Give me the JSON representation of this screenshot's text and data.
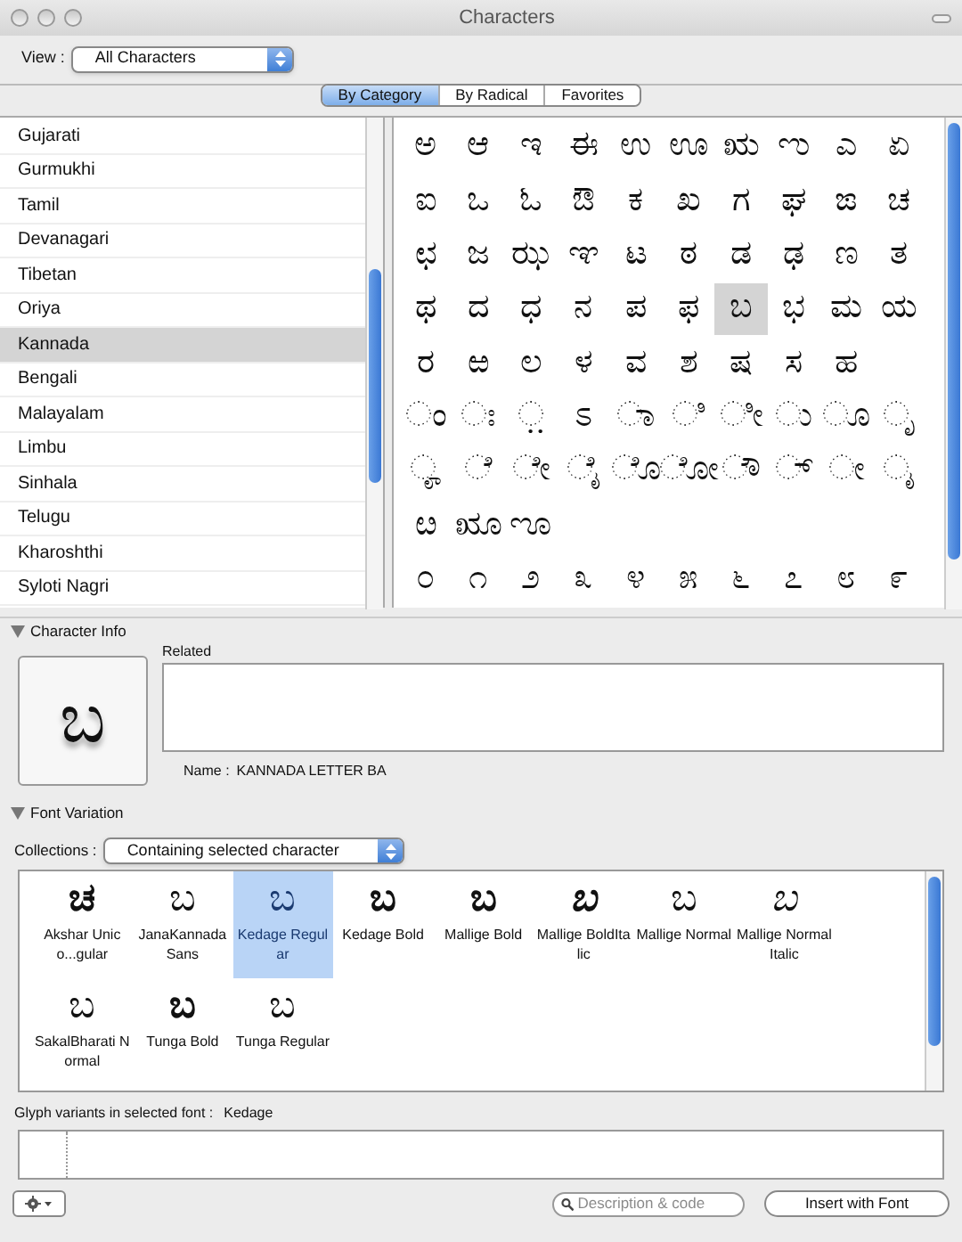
{
  "window": {
    "title": "Characters"
  },
  "view": {
    "label": "View :",
    "value": "All Characters"
  },
  "tabs": [
    {
      "label": "By Category",
      "selected": true
    },
    {
      "label": "By Radical",
      "selected": false
    },
    {
      "label": "Favorites",
      "selected": false
    }
  ],
  "categories": [
    {
      "label": "Gujarati",
      "selected": false
    },
    {
      "label": "Gurmukhi",
      "selected": false
    },
    {
      "label": "Tamil",
      "selected": false
    },
    {
      "label": "Devanagari",
      "selected": false
    },
    {
      "label": "Tibetan",
      "selected": false
    },
    {
      "label": "Oriya",
      "selected": false
    },
    {
      "label": "Kannada",
      "selected": true
    },
    {
      "label": "Bengali",
      "selected": false
    },
    {
      "label": "Malayalam",
      "selected": false
    },
    {
      "label": "Limbu",
      "selected": false
    },
    {
      "label": "Sinhala",
      "selected": false
    },
    {
      "label": "Telugu",
      "selected": false
    },
    {
      "label": "Kharoshthi",
      "selected": false
    },
    {
      "label": "Syloti Nagri",
      "selected": false
    }
  ],
  "character_grid": [
    [
      {
        "char": "ಅ",
        "selected": false
      },
      {
        "char": "ಆ",
        "selected": false
      },
      {
        "char": "ಇ",
        "selected": false
      },
      {
        "char": "ಈ",
        "selected": false
      },
      {
        "char": "ಉ",
        "selected": false
      },
      {
        "char": "ಊ",
        "selected": false
      },
      {
        "char": "ಋ",
        "selected": false
      },
      {
        "char": "ಌ",
        "selected": false
      },
      {
        "char": "ಎ",
        "selected": false
      },
      {
        "char": "ಏ",
        "selected": false
      }
    ],
    [
      {
        "char": "ಐ",
        "selected": false
      },
      {
        "char": "ಒ",
        "selected": false
      },
      {
        "char": "ಓ",
        "selected": false
      },
      {
        "char": "ಔ",
        "selected": false
      },
      {
        "char": "ಕ",
        "selected": false
      },
      {
        "char": "ಖ",
        "selected": false
      },
      {
        "char": "ಗ",
        "selected": false
      },
      {
        "char": "ಘ",
        "selected": false
      },
      {
        "char": "ಙ",
        "selected": false
      },
      {
        "char": "ಚ",
        "selected": false
      }
    ],
    [
      {
        "char": "ಛ",
        "selected": false
      },
      {
        "char": "ಜ",
        "selected": false
      },
      {
        "char": "ಝ",
        "selected": false
      },
      {
        "char": "ಞ",
        "selected": false
      },
      {
        "char": "ಟ",
        "selected": false
      },
      {
        "char": "ಠ",
        "selected": false
      },
      {
        "char": "ಡ",
        "selected": false
      },
      {
        "char": "ಢ",
        "selected": false
      },
      {
        "char": "ಣ",
        "selected": false
      },
      {
        "char": "ತ",
        "selected": false
      }
    ],
    [
      {
        "char": "ಥ",
        "selected": false
      },
      {
        "char": "ದ",
        "selected": false
      },
      {
        "char": "ಧ",
        "selected": false
      },
      {
        "char": "ನ",
        "selected": false
      },
      {
        "char": "ಪ",
        "selected": false
      },
      {
        "char": "ಫ",
        "selected": false
      },
      {
        "char": "ಬ",
        "selected": true
      },
      {
        "char": "ಭ",
        "selected": false
      },
      {
        "char": "ಮ",
        "selected": false
      },
      {
        "char": "ಯ",
        "selected": false
      }
    ],
    [
      {
        "char": "ರ",
        "selected": false
      },
      {
        "char": "ಱ",
        "selected": false
      },
      {
        "char": "ಲ",
        "selected": false
      },
      {
        "char": "ಳ",
        "selected": false
      },
      {
        "char": "ವ",
        "selected": false
      },
      {
        "char": "ಶ",
        "selected": false
      },
      {
        "char": "ಷ",
        "selected": false
      },
      {
        "char": "ಸ",
        "selected": false
      },
      {
        "char": "ಹ",
        "selected": false
      }
    ],
    [
      {
        "char": "ಂ",
        "selected": false
      },
      {
        "char": "ಃ",
        "selected": false
      },
      {
        "char": "಼",
        "selected": false
      },
      {
        "char": "ಽ",
        "selected": false
      },
      {
        "char": "ಾ",
        "selected": false
      },
      {
        "char": "ಿ",
        "selected": false
      },
      {
        "char": "ೀ",
        "selected": false
      },
      {
        "char": "ು",
        "selected": false
      },
      {
        "char": "ೂ",
        "selected": false
      },
      {
        "char": "ೃ",
        "selected": false
      }
    ],
    [
      {
        "char": "ೄ",
        "selected": false
      },
      {
        "char": "ೆ",
        "selected": false
      },
      {
        "char": "ೇ",
        "selected": false
      },
      {
        "char": "ೈ",
        "selected": false
      },
      {
        "char": "ೊ",
        "selected": false
      },
      {
        "char": "ೋ",
        "selected": false
      },
      {
        "char": "ೌ",
        "selected": false
      },
      {
        "char": "್",
        "selected": false
      },
      {
        "char": "ೕ",
        "selected": false
      },
      {
        "char": "ೖ",
        "selected": false
      }
    ],
    [
      {
        "char": "ೞ",
        "selected": false
      },
      {
        "char": "ೠ",
        "selected": false
      },
      {
        "char": "ೡ",
        "selected": false
      }
    ],
    [
      {
        "char": "೦",
        "selected": false
      },
      {
        "char": "೧",
        "selected": false
      },
      {
        "char": "೨",
        "selected": false
      },
      {
        "char": "೩",
        "selected": false
      },
      {
        "char": "೪",
        "selected": false
      },
      {
        "char": "೫",
        "selected": false
      },
      {
        "char": "೬",
        "selected": false
      },
      {
        "char": "೭",
        "selected": false
      },
      {
        "char": "೮",
        "selected": false
      },
      {
        "char": "೯",
        "selected": false
      }
    ]
  ],
  "character_info": {
    "header": "Character Info",
    "preview": "ಬ",
    "related_label": "Related",
    "name_label": "Name :",
    "name": "KANNADA LETTER BA"
  },
  "font_variation": {
    "header": "Font Variation",
    "collections_label": "Collections :",
    "collections_value": "Containing selected character",
    "fonts": [
      {
        "glyph": "ಚ",
        "label": "Akshar Unico...gular",
        "bold": true,
        "italic": false,
        "selected": false
      },
      {
        "glyph": "ಬ",
        "label": "JanaKannada Sans",
        "bold": false,
        "italic": false,
        "selected": false
      },
      {
        "glyph": "ಬ",
        "label": "Kedage Regular",
        "bold": false,
        "italic": false,
        "selected": true
      },
      {
        "glyph": "ಬ",
        "label": "Kedage Bold",
        "bold": true,
        "italic": false,
        "selected": false
      },
      {
        "glyph": "ಬ",
        "label": "Mallige Bold",
        "bold": true,
        "italic": false,
        "selected": false
      },
      {
        "glyph": "ಬ",
        "label": "Mallige BoldItalic",
        "bold": true,
        "italic": true,
        "selected": false
      },
      {
        "glyph": "ಬ",
        "label": "Mallige Normal",
        "bold": false,
        "italic": false,
        "selected": false
      },
      {
        "glyph": "ಬ",
        "label": "Mallige NormalItalic",
        "bold": false,
        "italic": true,
        "selected": false
      },
      {
        "glyph": "ಬ",
        "label": "SakalBharati Normal",
        "bold": false,
        "italic": false,
        "selected": false
      },
      {
        "glyph": "ಬ",
        "label": "Tunga Bold",
        "bold": true,
        "italic": false,
        "selected": false
      },
      {
        "glyph": "ಬ",
        "label": "Tunga Regular",
        "bold": false,
        "italic": false,
        "selected": false
      }
    ],
    "glyph_variants_label": "Glyph variants in selected font :",
    "glyph_variants_font": "Kedage"
  },
  "bottom_bar": {
    "search_placeholder": "Description & code",
    "insert_button": "Insert with Font"
  }
}
